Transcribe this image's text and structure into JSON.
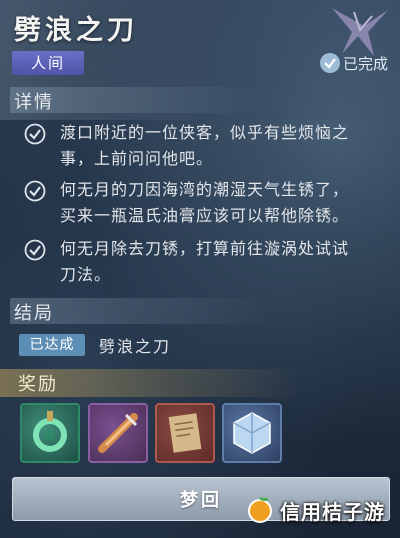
{
  "quest": {
    "title": "劈浪之刀",
    "category": "人间",
    "status": "已完成"
  },
  "details": {
    "heading": "详情",
    "items": [
      {
        "lines": [
          "渡口附近的一位侠客，似乎有些烦恼之",
          "事，上前问问他吧。"
        ]
      },
      {
        "lines": [
          "何无月的刀因海湾的潮湿天气生锈了，",
          "买来一瓶温氏油膏应该可以帮他除锈。"
        ]
      },
      {
        "lines": [
          "何无月除去刀锈，打算前往漩涡处试试",
          "刀法。"
        ]
      }
    ]
  },
  "ending": {
    "heading": "结局",
    "tag": "已达成",
    "name": "劈浪之刀"
  },
  "rewards": {
    "heading": "奖励",
    "items": [
      {
        "icon": "jade-pendant-icon",
        "frame": "#2f8a6a",
        "bg": "#1e4f45"
      },
      {
        "icon": "blade-scroll-icon",
        "frame": "#8a5ea0",
        "bg": "#5a3a63"
      },
      {
        "icon": "paper-note-icon",
        "frame": "#b0584f",
        "bg": "#6e3530"
      },
      {
        "icon": "crystal-cube-icon",
        "frame": "#5e7ea8",
        "bg": "#34466b"
      }
    ]
  },
  "button": {
    "label": "梦回"
  },
  "watermark": {
    "text": "信用桔子游"
  }
}
